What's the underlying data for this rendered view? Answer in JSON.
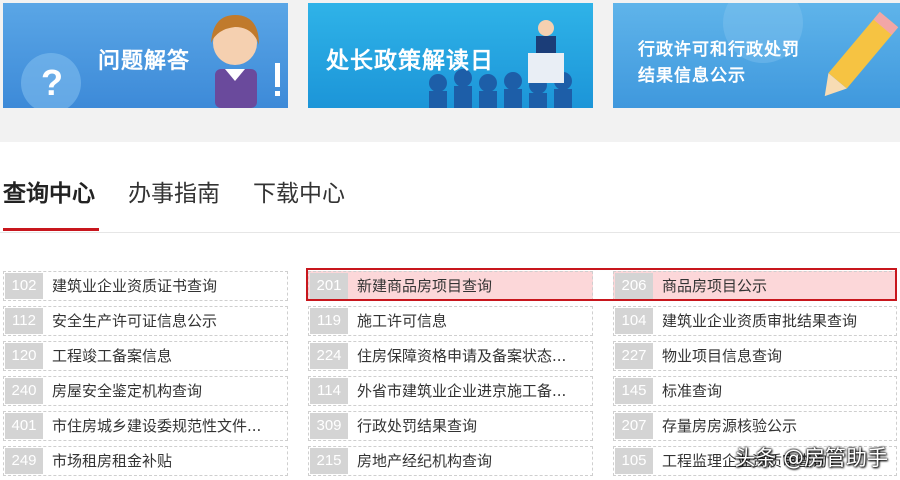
{
  "banners": [
    {
      "title": "问题解答"
    },
    {
      "title": "处长政策解读日"
    },
    {
      "title_line1": "行政许可和行政处罚",
      "title_line2": "结果信息公示"
    }
  ],
  "tabs": [
    {
      "label": "查询中心"
    },
    {
      "label": "办事指南"
    },
    {
      "label": "下载中心"
    }
  ],
  "items": [
    [
      {
        "num": "102",
        "label": "建筑业企业资质证书查询"
      },
      {
        "num": "112",
        "label": "安全生产许可证信息公示"
      },
      {
        "num": "120",
        "label": "工程竣工备案信息"
      },
      {
        "num": "240",
        "label": "房屋安全鉴定机构查询"
      },
      {
        "num": "401",
        "label": "市住房城乡建设委规范性文件..."
      },
      {
        "num": "249",
        "label": "市场租房租金补贴"
      }
    ],
    [
      {
        "num": "201",
        "label": "新建商品房项目查询"
      },
      {
        "num": "119",
        "label": "施工许可信息"
      },
      {
        "num": "224",
        "label": "住房保障资格申请及备案状态..."
      },
      {
        "num": "114",
        "label": "外省市建筑业企业进京施工备..."
      },
      {
        "num": "309",
        "label": "行政处罚结果查询"
      },
      {
        "num": "215",
        "label": "房地产经纪机构查询"
      }
    ],
    [
      {
        "num": "206",
        "label": "商品房项目公示"
      },
      {
        "num": "104",
        "label": "建筑业企业资质审批结果查询"
      },
      {
        "num": "227",
        "label": "物业项目信息查询"
      },
      {
        "num": "145",
        "label": "标准查询"
      },
      {
        "num": "207",
        "label": "存量房房源核验公示"
      },
      {
        "num": "105",
        "label": "工程监理企业资质审查询"
      }
    ]
  ],
  "watermark": "头条 @房管助手",
  "colors": {
    "accent": "#c8161d",
    "highlight": "#fcd7d9",
    "badge": "#d4d4d4"
  }
}
